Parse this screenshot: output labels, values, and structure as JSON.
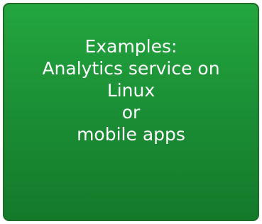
{
  "card": {
    "lines": [
      "Examples:",
      "Analytics service on",
      "Linux",
      "or",
      "mobile apps"
    ],
    "colors": {
      "fill_top": "#23a63f",
      "fill_bottom": "#137a2a",
      "border": "#1e6b2a",
      "text": "#ffffff"
    }
  }
}
